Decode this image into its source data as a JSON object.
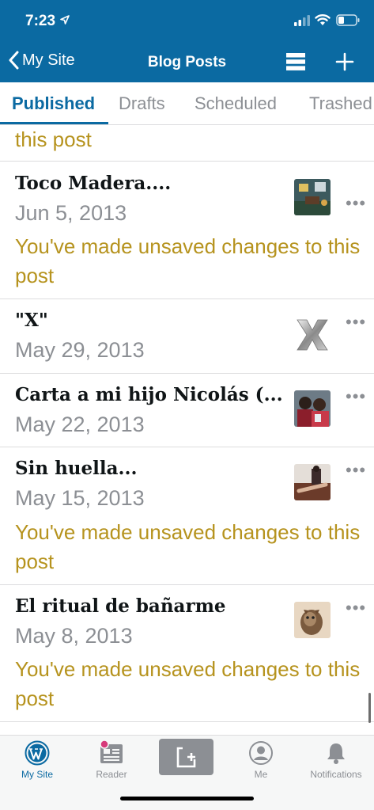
{
  "status_bar": {
    "time": "7:23"
  },
  "nav": {
    "back_label": "My Site",
    "title": "Blog Posts"
  },
  "tabs": [
    {
      "label": "Published",
      "active": true
    },
    {
      "label": "Drafts",
      "active": false
    },
    {
      "label": "Scheduled",
      "active": false
    },
    {
      "label": "Trashed",
      "active": false
    }
  ],
  "posts": {
    "partial_note": "this post",
    "items": [
      {
        "title": "Toco Madera....",
        "date": "Jun 5, 2013",
        "note": "You've made unsaved changes to this post",
        "thumbnail": "room-photo"
      },
      {
        "title": "\"X\"",
        "date": "May 29, 2013",
        "note": "",
        "thumbnail": "metallic-x"
      },
      {
        "title": "Carta a mi hijo Nicolás (...",
        "date": "May 22, 2013",
        "note": "",
        "thumbnail": "people-photo"
      },
      {
        "title": "Sin huella...",
        "date": "May 15, 2013",
        "note": "You've made unsaved changes to this post",
        "thumbnail": "hand-photo"
      },
      {
        "title": "El ritual de bañarme",
        "date": "May 8, 2013",
        "note": "You've made unsaved changes to this post",
        "thumbnail": "cat-photo"
      }
    ],
    "more_label": "•••"
  },
  "bottom_tabs": [
    {
      "label": "My Site",
      "icon": "wordpress-icon",
      "active": true
    },
    {
      "label": "Reader",
      "icon": "reader-icon",
      "active": false
    },
    {
      "label": "Me",
      "icon": "person-icon",
      "active": false
    },
    {
      "label": "Notifications",
      "icon": "bell-icon",
      "active": false
    }
  ],
  "colors": {
    "brand_blue": "#0b6aa2",
    "unsaved_gold": "#b6931e",
    "secondary_gray": "#8c8f94",
    "reader_badge_pink": "#d63a7a"
  }
}
